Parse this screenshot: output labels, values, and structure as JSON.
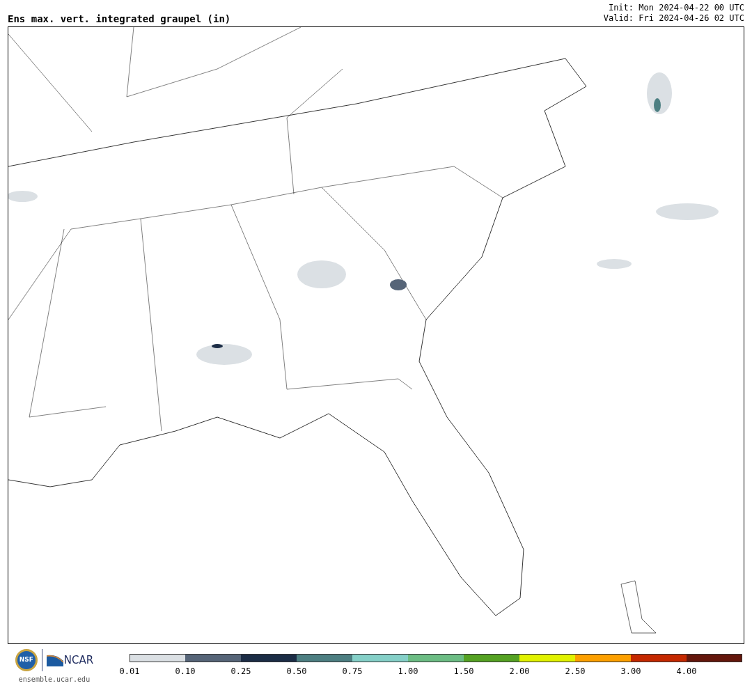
{
  "title": "Ens max. vert. integrated graupel (in)",
  "init": "Init: Mon 2024-04-22 00 UTC",
  "valid": "Valid: Fri 2024-04-26 02 UTC",
  "logos": {
    "nsf": "NSF",
    "ncar": "NCAR",
    "site": "ensemble.ucar.edu"
  },
  "colorbar": [
    {
      "label": "0.01",
      "color": "#dbe0e4"
    },
    {
      "label": "0.10",
      "color": "#566578"
    },
    {
      "label": "0.25",
      "color": "#1c2d46"
    },
    {
      "label": "0.50",
      "color": "#4d7f82"
    },
    {
      "label": "0.75",
      "color": "#85d0c8"
    },
    {
      "label": "1.00",
      "color": "#6cbd84"
    },
    {
      "label": "1.50",
      "color": "#55a223"
    },
    {
      "label": "2.00",
      "color": "#e1f200"
    },
    {
      "label": "2.50",
      "color": "#fda000"
    },
    {
      "label": "3.00",
      "color": "#c52900"
    },
    {
      "label": "4.00",
      "color": "#64170c"
    }
  ]
}
